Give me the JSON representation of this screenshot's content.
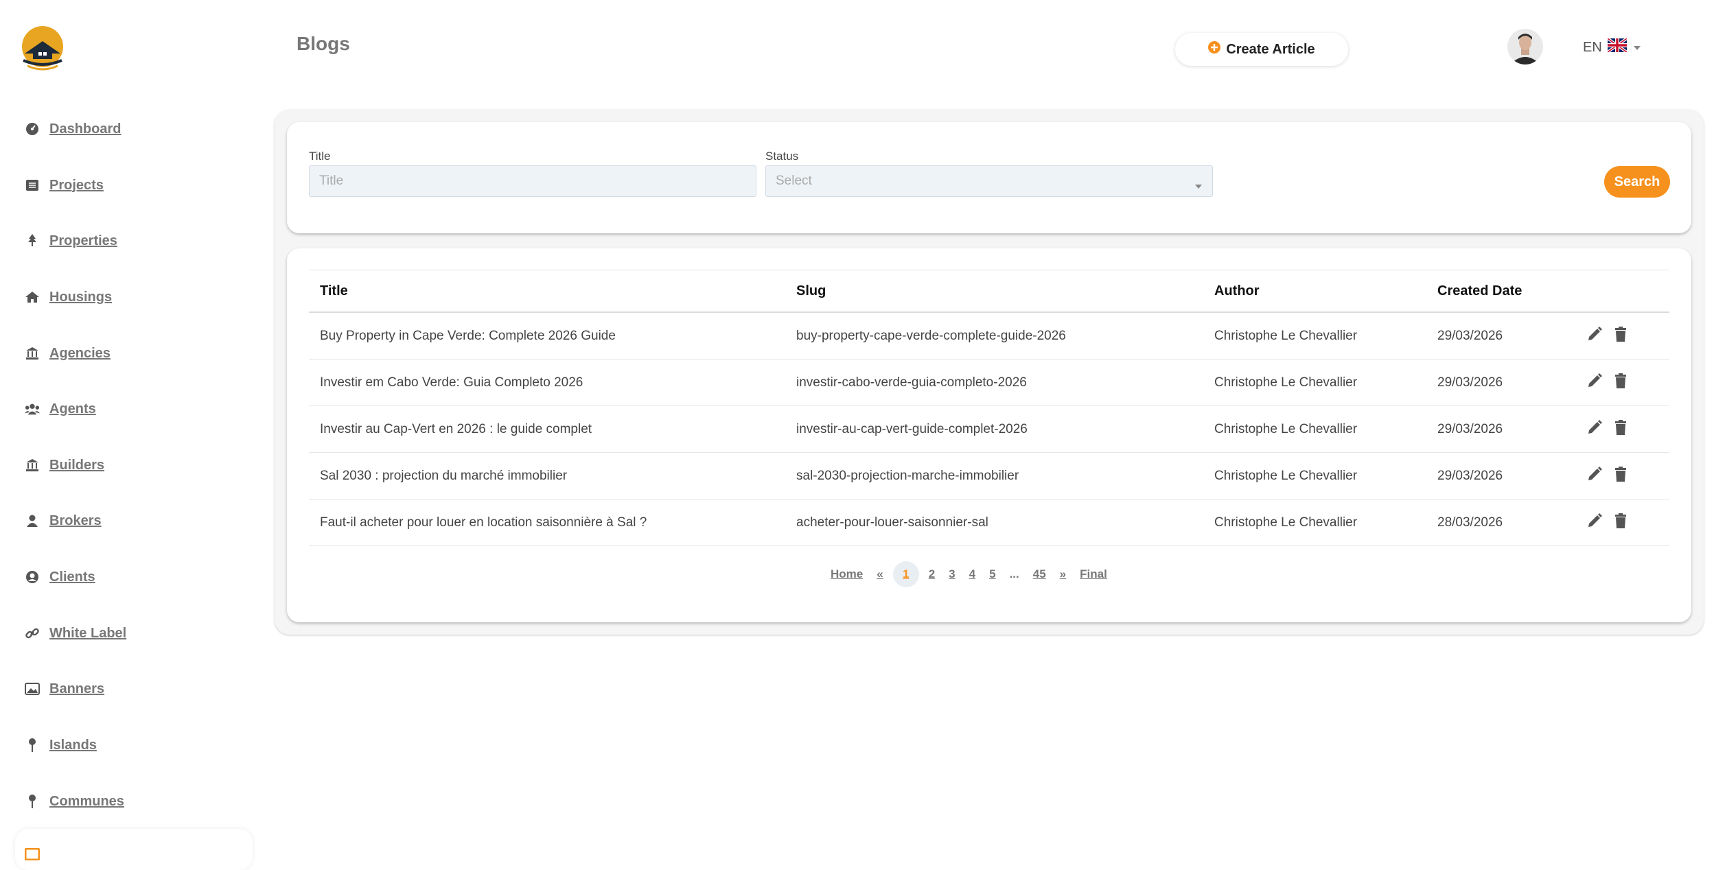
{
  "sidebar": {
    "items": [
      {
        "label": "Dashboard",
        "icon": "dashboard-icon"
      },
      {
        "label": "Projects",
        "icon": "list-icon"
      },
      {
        "label": "Properties",
        "icon": "tree-icon"
      },
      {
        "label": "Housings",
        "icon": "home-icon"
      },
      {
        "label": "Agencies",
        "icon": "bank-icon"
      },
      {
        "label": "Agents",
        "icon": "users-icon"
      },
      {
        "label": "Builders",
        "icon": "bank-icon"
      },
      {
        "label": "Brokers",
        "icon": "user-icon"
      },
      {
        "label": "Clients",
        "icon": "user-circle-icon"
      },
      {
        "label": "White Label",
        "icon": "link-icon"
      },
      {
        "label": "Banners",
        "icon": "image-icon"
      },
      {
        "label": "Islands",
        "icon": "pin-icon"
      },
      {
        "label": "Communes",
        "icon": "pin-icon"
      }
    ]
  },
  "header": {
    "title": "Blogs",
    "create_label": "Create Article",
    "lang": "EN"
  },
  "filters": {
    "title_label": "Title",
    "title_placeholder": "Title",
    "status_label": "Status",
    "status_placeholder": "Select",
    "search_label": "Search"
  },
  "table": {
    "columns": [
      "Title",
      "Slug",
      "Author",
      "Created Date"
    ],
    "rows": [
      [
        "Buy Property in Cape Verde: Complete 2026 Guide",
        "buy-property-cape-verde-complete-guide-2026",
        "Christophe Le Chevallier",
        "29/03/2026"
      ],
      [
        "Investir em Cabo Verde: Guia Completo 2026",
        "investir-cabo-verde-guia-completo-2026",
        "Christophe Le Chevallier",
        "29/03/2026"
      ],
      [
        "Investir au Cap-Vert en 2026 : le guide complet",
        "investir-au-cap-vert-guide-complet-2026",
        "Christophe Le Chevallier",
        "29/03/2026"
      ],
      [
        "Sal 2030 : projection du marché immobilier",
        "sal-2030-projection-marche-immobilier",
        "Christophe Le Chevallier",
        "29/03/2026"
      ],
      [
        "Faut-il acheter pour louer en location saisonnière à Sal ?",
        "acheter-pour-louer-saisonnier-sal",
        "Christophe Le Chevallier",
        "28/03/2026"
      ]
    ]
  },
  "pagination": {
    "home": "Home",
    "prev": "«",
    "pages": [
      "1",
      "2",
      "3",
      "4",
      "5"
    ],
    "ellipsis": "...",
    "last_page": "45",
    "next": "»",
    "final": "Final",
    "current": "1"
  },
  "colors": {
    "accent": "#f6911e",
    "muted_text": "#777777",
    "panel_bg": "#f5f5f5"
  }
}
